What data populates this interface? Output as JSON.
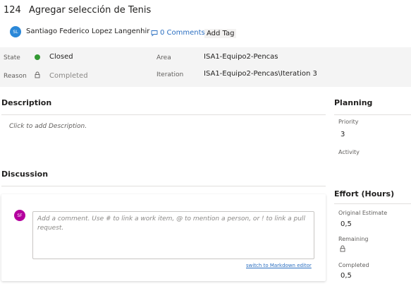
{
  "work_item": {
    "id": "124",
    "title": "Agregar selección de Tenis",
    "owner": {
      "initials": "SL",
      "name": "Santiago Federico Lopez Langenhir",
      "color": "#2b88d8"
    },
    "comments_link": "0 Comments",
    "add_tag": "Add Tag"
  },
  "fields": {
    "state": {
      "label": "State",
      "value": "Closed",
      "status_color": "#339933"
    },
    "reason": {
      "label": "Reason",
      "value": "Completed"
    },
    "area": {
      "label": "Area",
      "value": "ISA1-Equipo2-Pencas"
    },
    "iteration": {
      "label": "Iteration",
      "value": "ISA1-Equipo2-Pencas\\Iteration 3"
    }
  },
  "description": {
    "title": "Description",
    "placeholder": "Click to add Description."
  },
  "discussion": {
    "title": "Discussion",
    "avatar_initials": "SF",
    "avatar_color": "#b4009e",
    "placeholder": "Add a comment. Use # to link a work item, @ to mention a person, or ! to link a pull request.",
    "markdown_link": "switch to Markdown editor"
  },
  "planning": {
    "title": "Planning",
    "priority_label": "Priority",
    "priority_value": "3",
    "activity_label": "Activity"
  },
  "effort": {
    "title": "Effort (Hours)",
    "original_estimate_label": "Original Estimate",
    "original_estimate_value": "0,5",
    "remaining_label": "Remaining",
    "completed_label": "Completed",
    "completed_value": "0,5"
  }
}
